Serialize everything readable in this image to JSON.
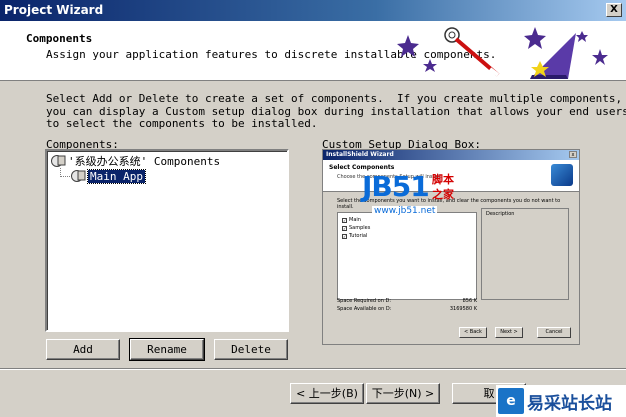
{
  "window": {
    "title": "Project Wizard",
    "close_glyph": "X"
  },
  "header": {
    "title": "Components",
    "description": "Assign your application features to discrete installable components."
  },
  "intro_text": "Select Add or Delete to create a set of components.  If you create multiple components,\nyou can display a Custom setup dialog box during installation that allows your end users\nto select the components to be installed.",
  "components": {
    "label": "Components:",
    "root": "'系级办公系统' Components",
    "child": "Main App"
  },
  "preview": {
    "label": "Custom Setup Dialog Box:",
    "title": "InstallShield Wizard",
    "close_glyph": "x",
    "heading": "Select Components",
    "subheading": "Choose the components Setup will install.",
    "instructions": "Select the components you want to install, and clear the components you do not want to install.",
    "items": [
      "Main",
      "Samples",
      "Tutorial"
    ],
    "description_label": "Description",
    "space_required_label": "Space Required on  D:",
    "space_required_value": "856 K",
    "space_available_label": "Space Available on  D:",
    "space_available_value": "3169580 K",
    "back": "< Back",
    "next": "Next >",
    "cancel": "Cancel"
  },
  "buttons": {
    "add": "Add",
    "rename": "Rename",
    "delete": "Delete",
    "back": "< 上一步(B)",
    "next": "下一步(N) >",
    "cancel": "取"
  },
  "watermark": {
    "brand": "JB51",
    "cn_top": "脚本",
    "cn_bottom": "之家",
    "url": "www.jb51.net",
    "corner_text": "易采站长站"
  },
  "icons": [
    "wizard-hat-icon",
    "stars-icon",
    "magic-wand-icon",
    "component-icon"
  ]
}
